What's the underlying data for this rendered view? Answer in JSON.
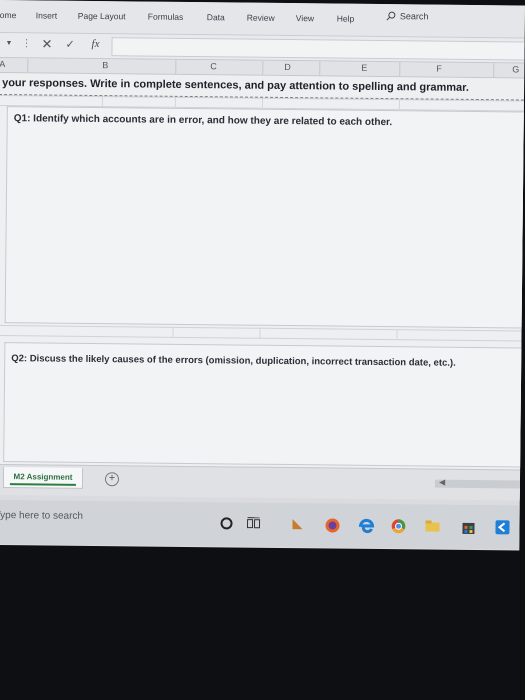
{
  "ribbon": {
    "tabs": [
      "ome",
      "Insert",
      "Page Layout",
      "Formulas",
      "Data",
      "Review",
      "View",
      "Help"
    ],
    "search_label": "Search"
  },
  "formula_bar": {
    "fx_label": "fx",
    "cancel_glyph": "✕",
    "enter_glyph": "✓"
  },
  "columns": [
    "A",
    "B",
    "C",
    "D",
    "E",
    "F",
    "G"
  ],
  "sheet": {
    "instruction": "your responses. Write in complete sentences, and pay attention to spelling and grammar.",
    "q1": "Q1: Identify which accounts are in error, and how they are related to each other.",
    "q2": "Q2: Discuss the likely causes of the errors (omission, duplication, incorrect transaction date, etc.)."
  },
  "sheet_tabs": {
    "active": "M2 Assignment",
    "add_symbol": "+"
  },
  "taskbar": {
    "search_placeholder": "Type here to search",
    "icons": [
      "cortana-icon",
      "task-view-icon",
      "file-explorer-icon",
      "firefox-icon",
      "edge-icon",
      "chrome-icon",
      "folder-icon",
      "store-icon",
      "vscode-icon"
    ]
  },
  "colors": {
    "excel_green": "#2f7d3f",
    "firefox_orange": "#e8652a",
    "edge_blue": "#1f7fd6"
  }
}
